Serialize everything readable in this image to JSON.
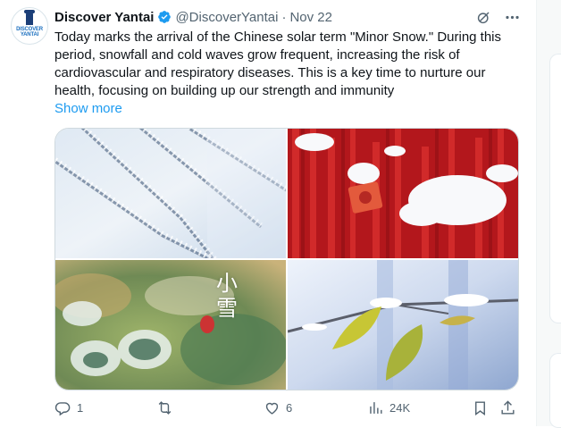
{
  "tweet": {
    "author": {
      "display_name": "Discover Yantai",
      "handle": "@DiscoverYantai",
      "verified": true,
      "avatar_text": "DISCOVER YANTAI"
    },
    "separator": "·",
    "date": "Nov 22",
    "text": "Today marks the arrival of the Chinese solar term \"Minor Snow.\" During this period, snowfall and cold waves grow frequent, increasing the risk of cardiovascular and respiratory diseases. This is a key time to nurture our health, focusing on building up our strength and immunity",
    "show_more": "Show more",
    "photo_overlay_text": "小雪",
    "actions": {
      "reply_count": "1",
      "retweet_count": "",
      "like_count": "6",
      "view_count": "24K"
    }
  },
  "icons": [
    "verified-badge-icon",
    "grok-icon",
    "more-icon",
    "reply-icon",
    "retweet-icon",
    "like-icon",
    "views-icon",
    "bookmark-icon",
    "share-icon"
  ],
  "colors": {
    "accent": "#1d9bf0",
    "secondary_text": "#536471",
    "text": "#0f1419"
  }
}
